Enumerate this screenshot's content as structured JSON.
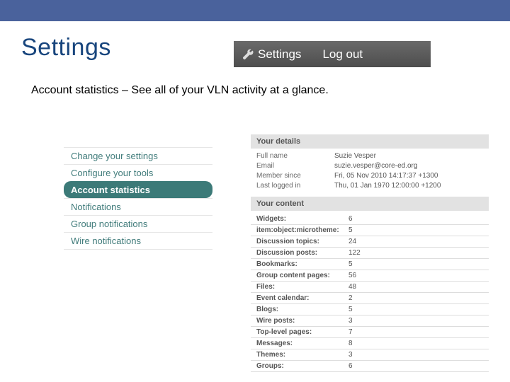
{
  "page_title": "Settings",
  "nav": {
    "settings_label": "Settings",
    "logout_label": "Log out"
  },
  "subtitle": "Account statistics – See all of your VLN activity at a glance.",
  "sidebar": {
    "items": [
      {
        "label": "Change your settings"
      },
      {
        "label": "Configure your tools"
      },
      {
        "label": "Account statistics"
      },
      {
        "label": "Notifications"
      },
      {
        "label": "Group notifications"
      },
      {
        "label": "Wire notifications"
      }
    ],
    "active_index": 2
  },
  "details_section": {
    "header": "Your details",
    "rows": [
      {
        "label": "Full name",
        "value": "Suzie Vesper"
      },
      {
        "label": "Email",
        "value": "suzie.vesper@core-ed.org"
      },
      {
        "label": "Member since",
        "value": "Fri, 05 Nov 2010 14:17:37 +1300"
      },
      {
        "label": "Last logged in",
        "value": "Thu, 01 Jan 1970 12:00:00 +1200"
      }
    ]
  },
  "content_section": {
    "header": "Your content",
    "rows": [
      {
        "label": "Widgets:",
        "value": "6"
      },
      {
        "label": "item:object:microtheme:",
        "value": "5"
      },
      {
        "label": "Discussion topics:",
        "value": "24"
      },
      {
        "label": "Discussion posts:",
        "value": "122"
      },
      {
        "label": "Bookmarks:",
        "value": "5"
      },
      {
        "label": "Group content pages:",
        "value": "56"
      },
      {
        "label": "Files:",
        "value": "48"
      },
      {
        "label": "Event calendar:",
        "value": "2"
      },
      {
        "label": "Blogs:",
        "value": "5"
      },
      {
        "label": "Wire posts:",
        "value": "3"
      },
      {
        "label": "Top-level pages:",
        "value": "7"
      },
      {
        "label": "Messages:",
        "value": "8"
      },
      {
        "label": "Themes:",
        "value": "3"
      },
      {
        "label": "Groups:",
        "value": "6"
      }
    ]
  }
}
